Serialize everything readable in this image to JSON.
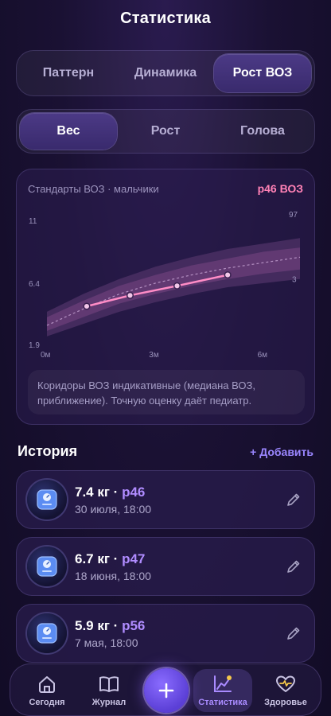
{
  "page": {
    "title": "Статистика"
  },
  "view_tabs": [
    {
      "label": "Паттерн",
      "active": false
    },
    {
      "label": "Динамика",
      "active": false
    },
    {
      "label": "Рост ВОЗ",
      "active": true
    }
  ],
  "metric_tabs": [
    {
      "label": "Вес",
      "active": true
    },
    {
      "label": "Рост",
      "active": false
    },
    {
      "label": "Голова",
      "active": false
    }
  ],
  "chart_card": {
    "subtitle": "Стандарты ВОЗ · мальчики",
    "percentile_badge": "p46 ВОЗ",
    "note": "Коридоры ВОЗ индикативные (медиана ВОЗ, приближение). Точную оценку даёт педиатр."
  },
  "chart_data": {
    "type": "line",
    "xlabel": "",
    "ylabel": "",
    "xlim": [
      0,
      7
    ],
    "ylim": [
      1.9,
      11
    ],
    "x_ticks": [
      {
        "value": 0,
        "label": "0м"
      },
      {
        "value": 3,
        "label": "3м"
      },
      {
        "value": 6,
        "label": "6м"
      }
    ],
    "y_ticks": [
      {
        "value": 11,
        "label": "11"
      },
      {
        "value": 6.4,
        "label": "6.4"
      },
      {
        "value": 1.9,
        "label": "1.9"
      }
    ],
    "band_labels": {
      "upper": "97",
      "lower": "3"
    },
    "bands": {
      "x": [
        0,
        1,
        2,
        3,
        4,
        5,
        6,
        7
      ],
      "p3": [
        2.5,
        3.4,
        4.3,
        5.0,
        5.6,
        6.1,
        6.4,
        6.7
      ],
      "p15": [
        2.9,
        3.9,
        4.9,
        5.6,
        6.2,
        6.7,
        7.1,
        7.4
      ],
      "p85": [
        3.9,
        5.1,
        6.2,
        7.0,
        7.7,
        8.2,
        8.7,
        9.0
      ],
      "p97": [
        4.3,
        5.6,
        6.7,
        7.6,
        8.3,
        8.9,
        9.3,
        9.7
      ],
      "median": [
        3.3,
        4.5,
        5.6,
        6.4,
        7.0,
        7.5,
        7.9,
        8.3
      ]
    },
    "series": [
      {
        "x": [
          1.1,
          2.3,
          3.6,
          5.0
        ],
        "y": [
          4.7,
          5.5,
          6.2,
          7.0
        ]
      }
    ],
    "colors": {
      "band_outer": "#4a2f63",
      "band_inner": "#6b3f7a",
      "line": "#ff8cc6",
      "point_fill": "#f2c6e8"
    }
  },
  "history": {
    "title": "История",
    "add_label": "+ Добавить",
    "entries": [
      {
        "value": "7.4 кг",
        "sep": " · ",
        "percentile": "p46",
        "date": "30 июля, 18:00"
      },
      {
        "value": "6.7 кг",
        "sep": " · ",
        "percentile": "p47",
        "date": "18 июня, 18:00"
      },
      {
        "value": "5.9 кг",
        "sep": " · ",
        "percentile": "p56",
        "date": "7 мая, 18:00"
      }
    ]
  },
  "tabbar": {
    "items": [
      {
        "label": "Сегодня",
        "icon": "home-icon"
      },
      {
        "label": "Журнал",
        "icon": "book-icon"
      },
      {
        "label": "Статистика",
        "icon": "chart-icon",
        "active": true
      },
      {
        "label": "Здоровье",
        "icon": "heart-icon"
      }
    ]
  }
}
